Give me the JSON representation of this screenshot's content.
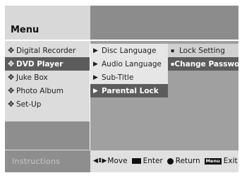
{
  "header": {
    "title": "Menu"
  },
  "main_menu": {
    "items": [
      {
        "label": "Digital Recorder",
        "selected": false
      },
      {
        "label": "DVD Player",
        "selected": true
      },
      {
        "label": "Juke Box",
        "selected": false
      },
      {
        "label": "Photo Album",
        "selected": false
      },
      {
        "label": "Set-Up",
        "selected": false
      }
    ]
  },
  "sub_menu": {
    "items": [
      {
        "label": "Disc Language",
        "selected": false
      },
      {
        "label": "Audio Language",
        "selected": false
      },
      {
        "label": "Sub-Title",
        "selected": false
      },
      {
        "label": "Parental Lock",
        "selected": true
      }
    ]
  },
  "option_menu": {
    "items": [
      {
        "label": "Lock Setting",
        "selected": false
      },
      {
        "label": "Change Password",
        "selected": true
      }
    ]
  },
  "footer": {
    "instructions_label": "Instructions",
    "move_label": "Move",
    "enter_label": "Enter",
    "return_label": "Return",
    "menu_key_label": "Menu",
    "exit_label": "Exit"
  },
  "icons": {
    "main_menu_bullet": "plus-icon",
    "sub_menu_bullet": "chevron-right-icon",
    "option_bullet": "dot-icon",
    "move": "four-way-arrow-icon",
    "enter": "enter-key-icon",
    "return": "return-circle-icon"
  },
  "colors": {
    "selected_bg": "#5c5c5c",
    "header_right": "#8c8c8c",
    "panel_light": "#dcdcdc"
  }
}
